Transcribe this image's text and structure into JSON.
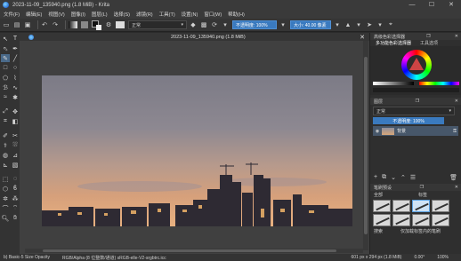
{
  "window": {
    "title": "2023-11-09_135940.png (1.8 MiB) - Krita",
    "controls": [
      "—",
      "☐",
      "✕"
    ]
  },
  "menu": [
    "文件(F)",
    "编辑(E)",
    "视图(V)",
    "图像(I)",
    "图层(L)",
    "选择(S)",
    "滤镜(R)",
    "工具(T)",
    "设置(N)",
    "窗口(W)",
    "帮助(H)"
  ],
  "toolbar": {
    "blend_mode": "正常",
    "opacity_label": "不透明度: 100%",
    "size_label": "大小: 40.00 像素"
  },
  "document": {
    "tab_title": "2023-11-09_135940.png (1.8 MiB)",
    "close": "✕"
  },
  "dockers": {
    "color_title": "高级色彩选择器",
    "color_tabs": [
      "多功能色彩选择器",
      "工具选项"
    ],
    "layers_title": "图层",
    "blend_mode": "正常",
    "layers_opacity": "不透明度: 100%",
    "layer_name": "背景",
    "brush_title": "笔刷预设",
    "brush_filter": "全部",
    "brush_tag": "标签",
    "brush_search_label": "搜索",
    "brush_checkbox": "仅加载标签内的笔刷"
  },
  "statusbar": {
    "tool": "b) Basic-5 Size Opacity",
    "color_space": "RGB/Alpha (8 位整数/通道)  sRGB-elle-V2-srgbtrc.icc",
    "dimensions": "601 px x 294 px (1.8 MiB)",
    "rotation": "0.00°",
    "zoom": "100%"
  },
  "colors": {
    "accent": "#3a7abf",
    "titlebar": "#3a3a3a",
    "canvas_bg": "#404040"
  }
}
